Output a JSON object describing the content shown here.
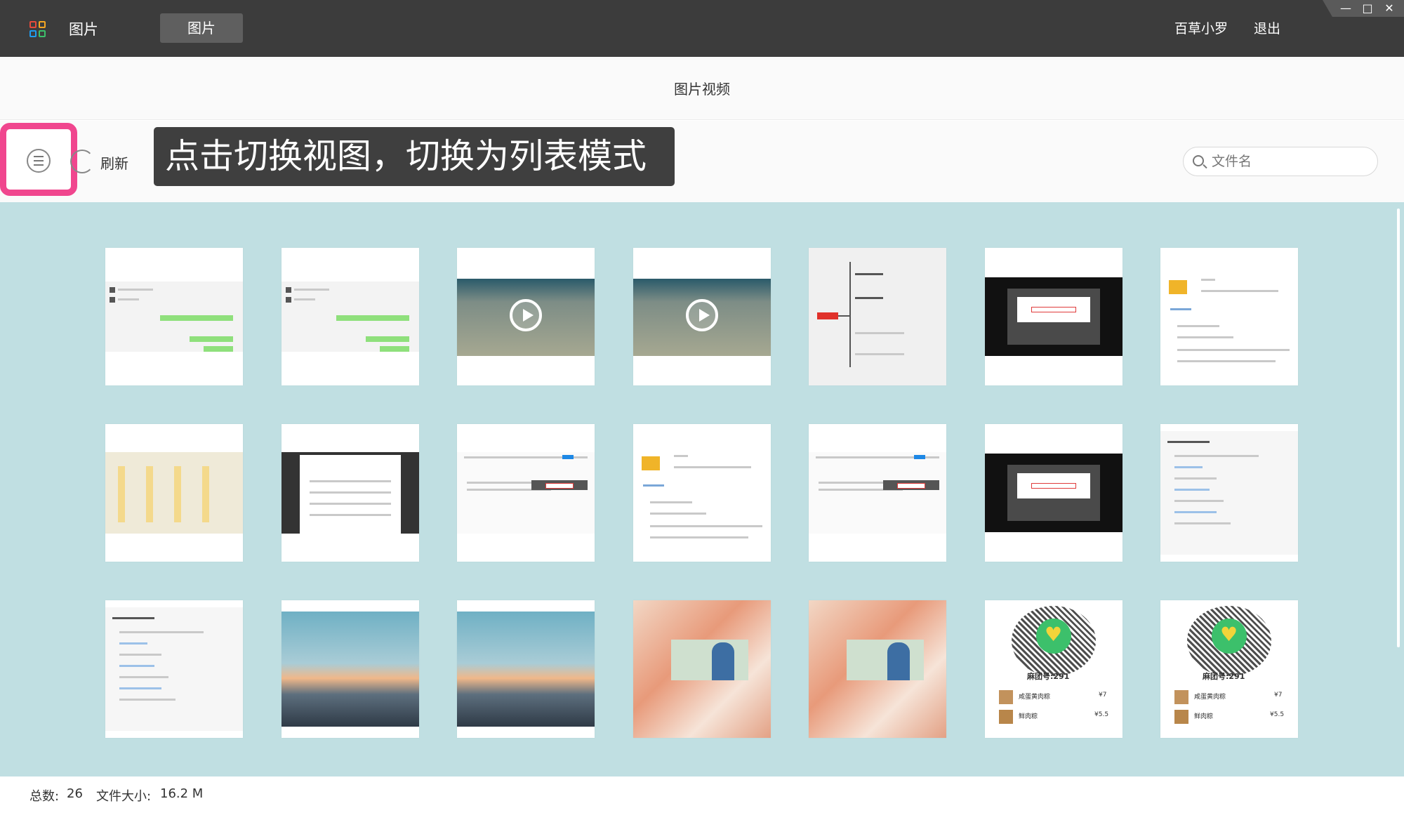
{
  "titlebar": {
    "app_title": "图片",
    "active_tab": "图片",
    "user_name": "百草小罗",
    "logout_label": "退出",
    "minimize_glyph": "—",
    "maximize_glyph": "□",
    "close_glyph": "✕"
  },
  "page": {
    "title": "图片视频"
  },
  "toolbar": {
    "refresh_label": "刷新",
    "tooltip_text": "点击切换视图，切换为列表模式",
    "search_placeholder": "文件名"
  },
  "grid": {
    "rows": [
      [
        "chat-screenshot",
        "chat-screenshot",
        "video",
        "video",
        "mindmap",
        "dark-dialog",
        "forklift-page"
      ],
      [
        "app-grid",
        "table-dialog",
        "web-form",
        "forklift-page",
        "web-form",
        "dark-dialog",
        "document-list"
      ],
      [
        "document-list",
        "sky-photo",
        "sky-photo",
        "portrait-slide",
        "portrait-slide",
        "qr-menu",
        "qr-menu"
      ]
    ],
    "qr_label": "麻团号:291",
    "menu_items": [
      {
        "name": "咸蛋黄肉粽",
        "price": "¥7"
      },
      {
        "name": "鲜肉粽",
        "price": "¥5.5"
      }
    ]
  },
  "footer": {
    "total_label": "总数:",
    "total_value": "26",
    "size_label": "文件大小:",
    "size_value": "16.2 M"
  },
  "colors": {
    "titlebar": "#3c3c3c",
    "content_bg": "#c0dfe2",
    "highlight": "#f0468e"
  }
}
